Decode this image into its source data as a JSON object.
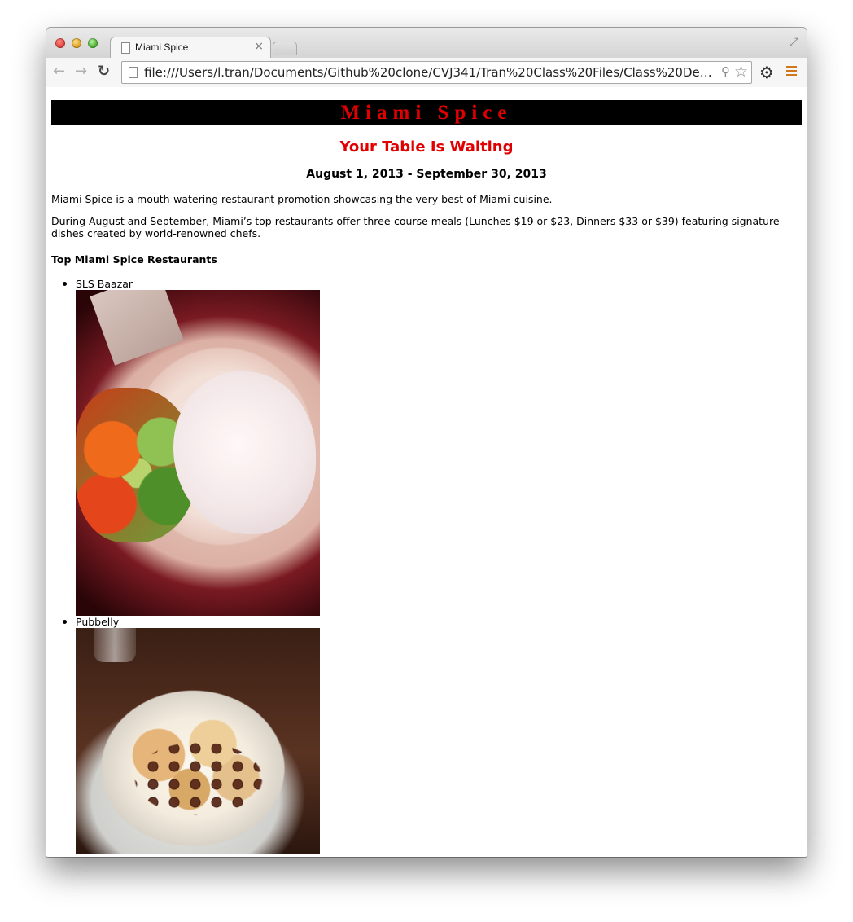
{
  "browser": {
    "tab_title": "Miami Spice",
    "tab_close": "×",
    "url": "file:///Users/l.tran/Documents/Github%20clone/CVJ341/Tran%20Class%20Files/Class%20Demo/da...",
    "icons": {
      "back": "back-arrow-icon",
      "forward": "forward-arrow-icon",
      "reload": "reload-icon",
      "search": "search-icon",
      "bookmark": "star-icon",
      "settings": "gear-icon",
      "menu": "menu-icon"
    }
  },
  "page": {
    "banner": "Miami Spice",
    "tagline": "Your Table Is Waiting",
    "dates": "August 1, 2013 - September 30, 2013",
    "intro": "Miami Spice is a mouth-watering restaurant promotion showcasing the very best of Miami cuisine.",
    "details": "During August and September, Miami’s top restaurants offer three-course meals (Lunches $19 or $23, Dinners $33 or $39) featuring signature dishes created by world-renowned chefs.",
    "list_heading": "Top Miami Spice Restaurants",
    "restaurants": [
      {
        "name": "SLS Baazar"
      },
      {
        "name": "Pubbelly"
      }
    ]
  },
  "colors": {
    "accent_red": "#e00000",
    "banner_bg": "#000000"
  }
}
